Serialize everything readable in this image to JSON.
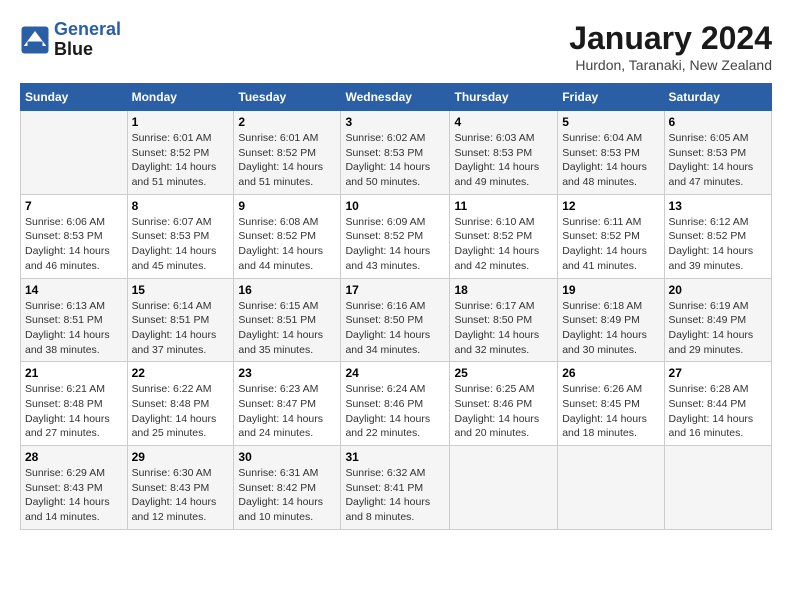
{
  "header": {
    "logo_line1": "General",
    "logo_line2": "Blue",
    "month": "January 2024",
    "location": "Hurdon, Taranaki, New Zealand"
  },
  "weekdays": [
    "Sunday",
    "Monday",
    "Tuesday",
    "Wednesday",
    "Thursday",
    "Friday",
    "Saturday"
  ],
  "weeks": [
    [
      {
        "day": "",
        "sunrise": "",
        "sunset": "",
        "daylight": ""
      },
      {
        "day": "1",
        "sunrise": "Sunrise: 6:01 AM",
        "sunset": "Sunset: 8:52 PM",
        "daylight": "Daylight: 14 hours and 51 minutes."
      },
      {
        "day": "2",
        "sunrise": "Sunrise: 6:01 AM",
        "sunset": "Sunset: 8:52 PM",
        "daylight": "Daylight: 14 hours and 51 minutes."
      },
      {
        "day": "3",
        "sunrise": "Sunrise: 6:02 AM",
        "sunset": "Sunset: 8:53 PM",
        "daylight": "Daylight: 14 hours and 50 minutes."
      },
      {
        "day": "4",
        "sunrise": "Sunrise: 6:03 AM",
        "sunset": "Sunset: 8:53 PM",
        "daylight": "Daylight: 14 hours and 49 minutes."
      },
      {
        "day": "5",
        "sunrise": "Sunrise: 6:04 AM",
        "sunset": "Sunset: 8:53 PM",
        "daylight": "Daylight: 14 hours and 48 minutes."
      },
      {
        "day": "6",
        "sunrise": "Sunrise: 6:05 AM",
        "sunset": "Sunset: 8:53 PM",
        "daylight": "Daylight: 14 hours and 47 minutes."
      }
    ],
    [
      {
        "day": "7",
        "sunrise": "Sunrise: 6:06 AM",
        "sunset": "Sunset: 8:53 PM",
        "daylight": "Daylight: 14 hours and 46 minutes."
      },
      {
        "day": "8",
        "sunrise": "Sunrise: 6:07 AM",
        "sunset": "Sunset: 8:53 PM",
        "daylight": "Daylight: 14 hours and 45 minutes."
      },
      {
        "day": "9",
        "sunrise": "Sunrise: 6:08 AM",
        "sunset": "Sunset: 8:52 PM",
        "daylight": "Daylight: 14 hours and 44 minutes."
      },
      {
        "day": "10",
        "sunrise": "Sunrise: 6:09 AM",
        "sunset": "Sunset: 8:52 PM",
        "daylight": "Daylight: 14 hours and 43 minutes."
      },
      {
        "day": "11",
        "sunrise": "Sunrise: 6:10 AM",
        "sunset": "Sunset: 8:52 PM",
        "daylight": "Daylight: 14 hours and 42 minutes."
      },
      {
        "day": "12",
        "sunrise": "Sunrise: 6:11 AM",
        "sunset": "Sunset: 8:52 PM",
        "daylight": "Daylight: 14 hours and 41 minutes."
      },
      {
        "day": "13",
        "sunrise": "Sunrise: 6:12 AM",
        "sunset": "Sunset: 8:52 PM",
        "daylight": "Daylight: 14 hours and 39 minutes."
      }
    ],
    [
      {
        "day": "14",
        "sunrise": "Sunrise: 6:13 AM",
        "sunset": "Sunset: 8:51 PM",
        "daylight": "Daylight: 14 hours and 38 minutes."
      },
      {
        "day": "15",
        "sunrise": "Sunrise: 6:14 AM",
        "sunset": "Sunset: 8:51 PM",
        "daylight": "Daylight: 14 hours and 37 minutes."
      },
      {
        "day": "16",
        "sunrise": "Sunrise: 6:15 AM",
        "sunset": "Sunset: 8:51 PM",
        "daylight": "Daylight: 14 hours and 35 minutes."
      },
      {
        "day": "17",
        "sunrise": "Sunrise: 6:16 AM",
        "sunset": "Sunset: 8:50 PM",
        "daylight": "Daylight: 14 hours and 34 minutes."
      },
      {
        "day": "18",
        "sunrise": "Sunrise: 6:17 AM",
        "sunset": "Sunset: 8:50 PM",
        "daylight": "Daylight: 14 hours and 32 minutes."
      },
      {
        "day": "19",
        "sunrise": "Sunrise: 6:18 AM",
        "sunset": "Sunset: 8:49 PM",
        "daylight": "Daylight: 14 hours and 30 minutes."
      },
      {
        "day": "20",
        "sunrise": "Sunrise: 6:19 AM",
        "sunset": "Sunset: 8:49 PM",
        "daylight": "Daylight: 14 hours and 29 minutes."
      }
    ],
    [
      {
        "day": "21",
        "sunrise": "Sunrise: 6:21 AM",
        "sunset": "Sunset: 8:48 PM",
        "daylight": "Daylight: 14 hours and 27 minutes."
      },
      {
        "day": "22",
        "sunrise": "Sunrise: 6:22 AM",
        "sunset": "Sunset: 8:48 PM",
        "daylight": "Daylight: 14 hours and 25 minutes."
      },
      {
        "day": "23",
        "sunrise": "Sunrise: 6:23 AM",
        "sunset": "Sunset: 8:47 PM",
        "daylight": "Daylight: 14 hours and 24 minutes."
      },
      {
        "day": "24",
        "sunrise": "Sunrise: 6:24 AM",
        "sunset": "Sunset: 8:46 PM",
        "daylight": "Daylight: 14 hours and 22 minutes."
      },
      {
        "day": "25",
        "sunrise": "Sunrise: 6:25 AM",
        "sunset": "Sunset: 8:46 PM",
        "daylight": "Daylight: 14 hours and 20 minutes."
      },
      {
        "day": "26",
        "sunrise": "Sunrise: 6:26 AM",
        "sunset": "Sunset: 8:45 PM",
        "daylight": "Daylight: 14 hours and 18 minutes."
      },
      {
        "day": "27",
        "sunrise": "Sunrise: 6:28 AM",
        "sunset": "Sunset: 8:44 PM",
        "daylight": "Daylight: 14 hours and 16 minutes."
      }
    ],
    [
      {
        "day": "28",
        "sunrise": "Sunrise: 6:29 AM",
        "sunset": "Sunset: 8:43 PM",
        "daylight": "Daylight: 14 hours and 14 minutes."
      },
      {
        "day": "29",
        "sunrise": "Sunrise: 6:30 AM",
        "sunset": "Sunset: 8:43 PM",
        "daylight": "Daylight: 14 hours and 12 minutes."
      },
      {
        "day": "30",
        "sunrise": "Sunrise: 6:31 AM",
        "sunset": "Sunset: 8:42 PM",
        "daylight": "Daylight: 14 hours and 10 minutes."
      },
      {
        "day": "31",
        "sunrise": "Sunrise: 6:32 AM",
        "sunset": "Sunset: 8:41 PM",
        "daylight": "Daylight: 14 hours and 8 minutes."
      },
      {
        "day": "",
        "sunrise": "",
        "sunset": "",
        "daylight": ""
      },
      {
        "day": "",
        "sunrise": "",
        "sunset": "",
        "daylight": ""
      },
      {
        "day": "",
        "sunrise": "",
        "sunset": "",
        "daylight": ""
      }
    ]
  ]
}
